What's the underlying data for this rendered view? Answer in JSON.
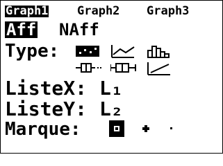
{
  "tabs": [
    {
      "label": "Graph1",
      "selected": true
    },
    {
      "label": "Graph2",
      "selected": false
    },
    {
      "label": "Graph3",
      "selected": false
    }
  ],
  "onoff": {
    "on_label": "Aff",
    "off_label": "NAff",
    "selected": "Aff"
  },
  "type_row": {
    "label": "Type:",
    "options": [
      {
        "icon": "scatter-plot-icon",
        "selected": true
      },
      {
        "icon": "xy-line-icon",
        "selected": false
      },
      {
        "icon": "histogram-icon",
        "selected": false
      },
      {
        "icon": "modified-boxplot-icon",
        "selected": false
      },
      {
        "icon": "boxplot-icon",
        "selected": false
      },
      {
        "icon": "normal-probability-plot-icon",
        "selected": false
      }
    ]
  },
  "xlist": {
    "label": "ListeX:",
    "value": "L₁"
  },
  "ylist": {
    "label": "ListeY:",
    "value": "L₂"
  },
  "mark": {
    "label": "Marque:",
    "options": [
      {
        "icon": "box-mark-icon",
        "selected": true
      },
      {
        "icon": "plus-mark-icon",
        "selected": false
      },
      {
        "icon": "dot-mark-icon",
        "selected": false
      }
    ]
  }
}
